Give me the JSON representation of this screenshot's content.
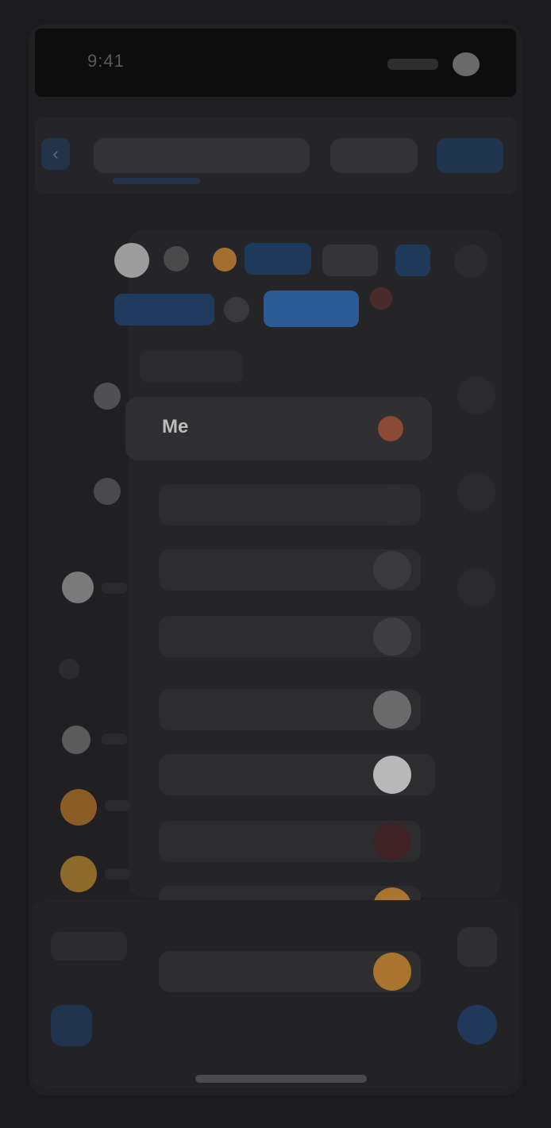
{
  "status": {
    "time": "9:41"
  },
  "toolbar": {
    "back_icon": "chevron-left-icon",
    "title": "",
    "filter": "",
    "action": ""
  },
  "panel": {
    "section_label": "",
    "selected_item": "Me",
    "rows": [
      {
        "label": ""
      },
      {
        "label": ""
      },
      {
        "label": ""
      },
      {
        "label": ""
      },
      {
        "label": ""
      },
      {
        "label": ""
      },
      {
        "label": ""
      },
      {
        "label": ""
      }
    ]
  },
  "bottom": {
    "left_label": ""
  },
  "colors": {
    "accent_blue": "#1f344e",
    "badge_orange": "#c88a3a",
    "badge_red": "#8a4a36",
    "highlight_blue": "#2a5b97"
  }
}
